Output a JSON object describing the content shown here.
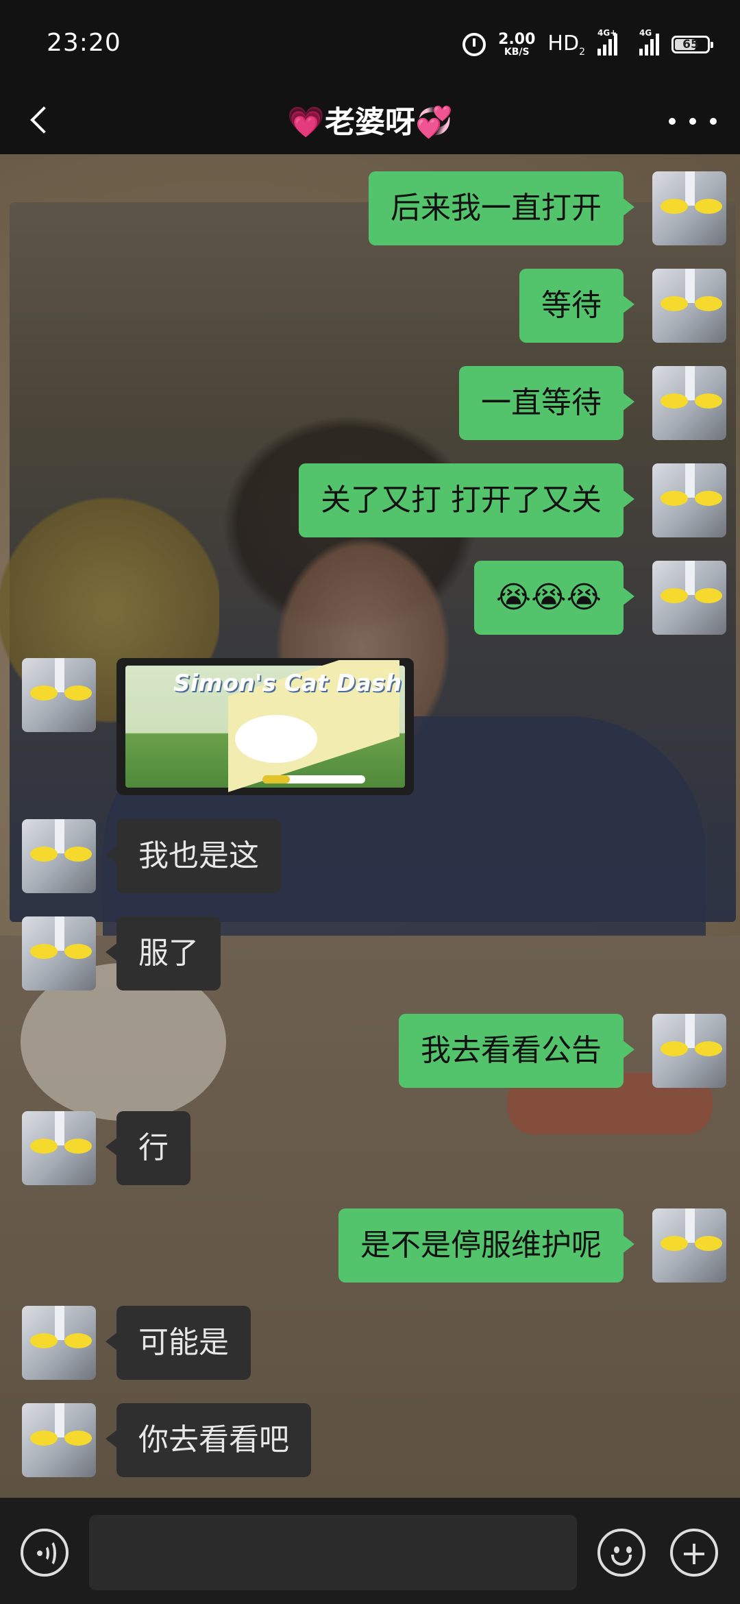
{
  "status_bar": {
    "time": "23:20",
    "net_speed_value": "2.00",
    "net_speed_unit": "KB/S",
    "hd_label": "HD",
    "hd_sub": "2",
    "sim1_tag": "4G+",
    "sim2_tag": "4G",
    "battery_level": "65",
    "icons": [
      "alarm-icon",
      "hd-icon",
      "signal-icon",
      "signal-icon",
      "battery-icon"
    ]
  },
  "header": {
    "title": "💗老婆呀💞",
    "back_icon": "chevron-left-icon",
    "more_icon": "more-dots-icon"
  },
  "messages": [
    {
      "dir": "out",
      "text": "后来我一直打开"
    },
    {
      "dir": "out",
      "text": "等待"
    },
    {
      "dir": "out",
      "text": "一直等待"
    },
    {
      "dir": "out",
      "text": "关了又打 打开了又关"
    },
    {
      "dir": "out",
      "text": "😭😭😭"
    },
    {
      "dir": "in",
      "type": "image",
      "image_title": "Simon's Cat Dash"
    },
    {
      "dir": "in",
      "text": "我也是这"
    },
    {
      "dir": "in",
      "text": "服了"
    },
    {
      "dir": "out",
      "text": "我去看看公告"
    },
    {
      "dir": "in",
      "text": "行"
    },
    {
      "dir": "out",
      "text": "是不是停服维护呢"
    },
    {
      "dir": "in",
      "text": "可能是"
    },
    {
      "dir": "in",
      "text": "你去看看吧"
    }
  ],
  "input_bar": {
    "voice_icon": "voice-icon",
    "text_value": "",
    "emoji_icon": "emoji-icon",
    "plus_icon": "plus-icon"
  },
  "colors": {
    "outgoing_bubble": "#53c46b",
    "incoming_bubble": "#2f2f2f",
    "top_bar": "#121212"
  }
}
